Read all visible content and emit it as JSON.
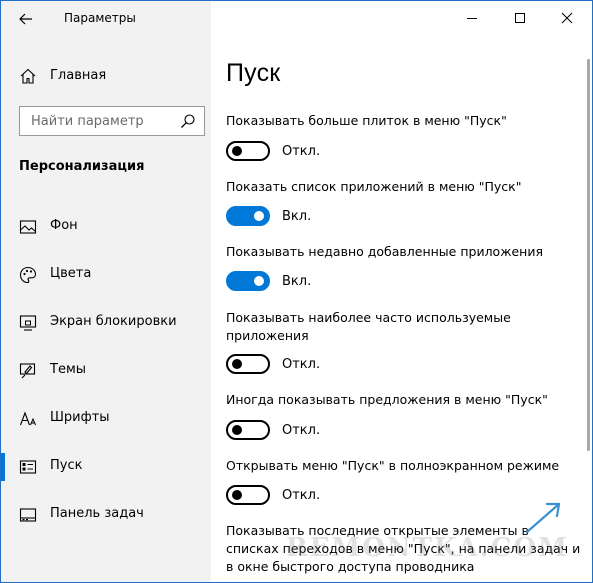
{
  "window": {
    "title": "Параметры",
    "controls": {
      "minimize": "minimize-icon",
      "maximize": "maximize-icon",
      "close": "close-icon"
    }
  },
  "sidebar": {
    "home_label": "Главная",
    "search_placeholder": "Найти параметр",
    "section_title": "Персонализация",
    "items": [
      {
        "label": "Фон",
        "icon": "picture-icon",
        "active": false
      },
      {
        "label": "Цвета",
        "icon": "palette-icon",
        "active": false
      },
      {
        "label": "Экран блокировки",
        "icon": "lock-screen-icon",
        "active": false
      },
      {
        "label": "Темы",
        "icon": "brush-icon",
        "active": false
      },
      {
        "label": "Шрифты",
        "icon": "font-icon",
        "active": false
      },
      {
        "label": "Пуск",
        "icon": "start-icon",
        "active": true
      },
      {
        "label": "Панель задач",
        "icon": "taskbar-icon",
        "active": false
      }
    ]
  },
  "main": {
    "page_title": "Пуск",
    "settings": [
      {
        "label": "Показывать больше плиток в меню \"Пуск\"",
        "state": "Откл.",
        "on": false
      },
      {
        "label": "Показать список приложений в меню \"Пуск\"",
        "state": "Вкл.",
        "on": true
      },
      {
        "label": "Показывать недавно добавленные приложения",
        "state": "Вкл.",
        "on": true
      },
      {
        "label": "Показывать наиболее часто используемые приложения",
        "state": "Откл.",
        "on": false
      },
      {
        "label": "Иногда показывать предложения в меню \"Пуск\"",
        "state": "Откл.",
        "on": false
      },
      {
        "label": "Открывать меню \"Пуск\" в полноэкранном режиме",
        "state": "Откл.",
        "on": false
      }
    ],
    "last_setting_label": "Показывать последние открытые элементы в списках переходов в меню \"Пуск\", на панели задач и в окне быстрого доступа проводника"
  },
  "watermark": "REMONTKA.COM",
  "colors": {
    "accent": "#0078d7",
    "sidebar_bg": "#f2f2f2",
    "arrow": "#3a8fd0"
  }
}
